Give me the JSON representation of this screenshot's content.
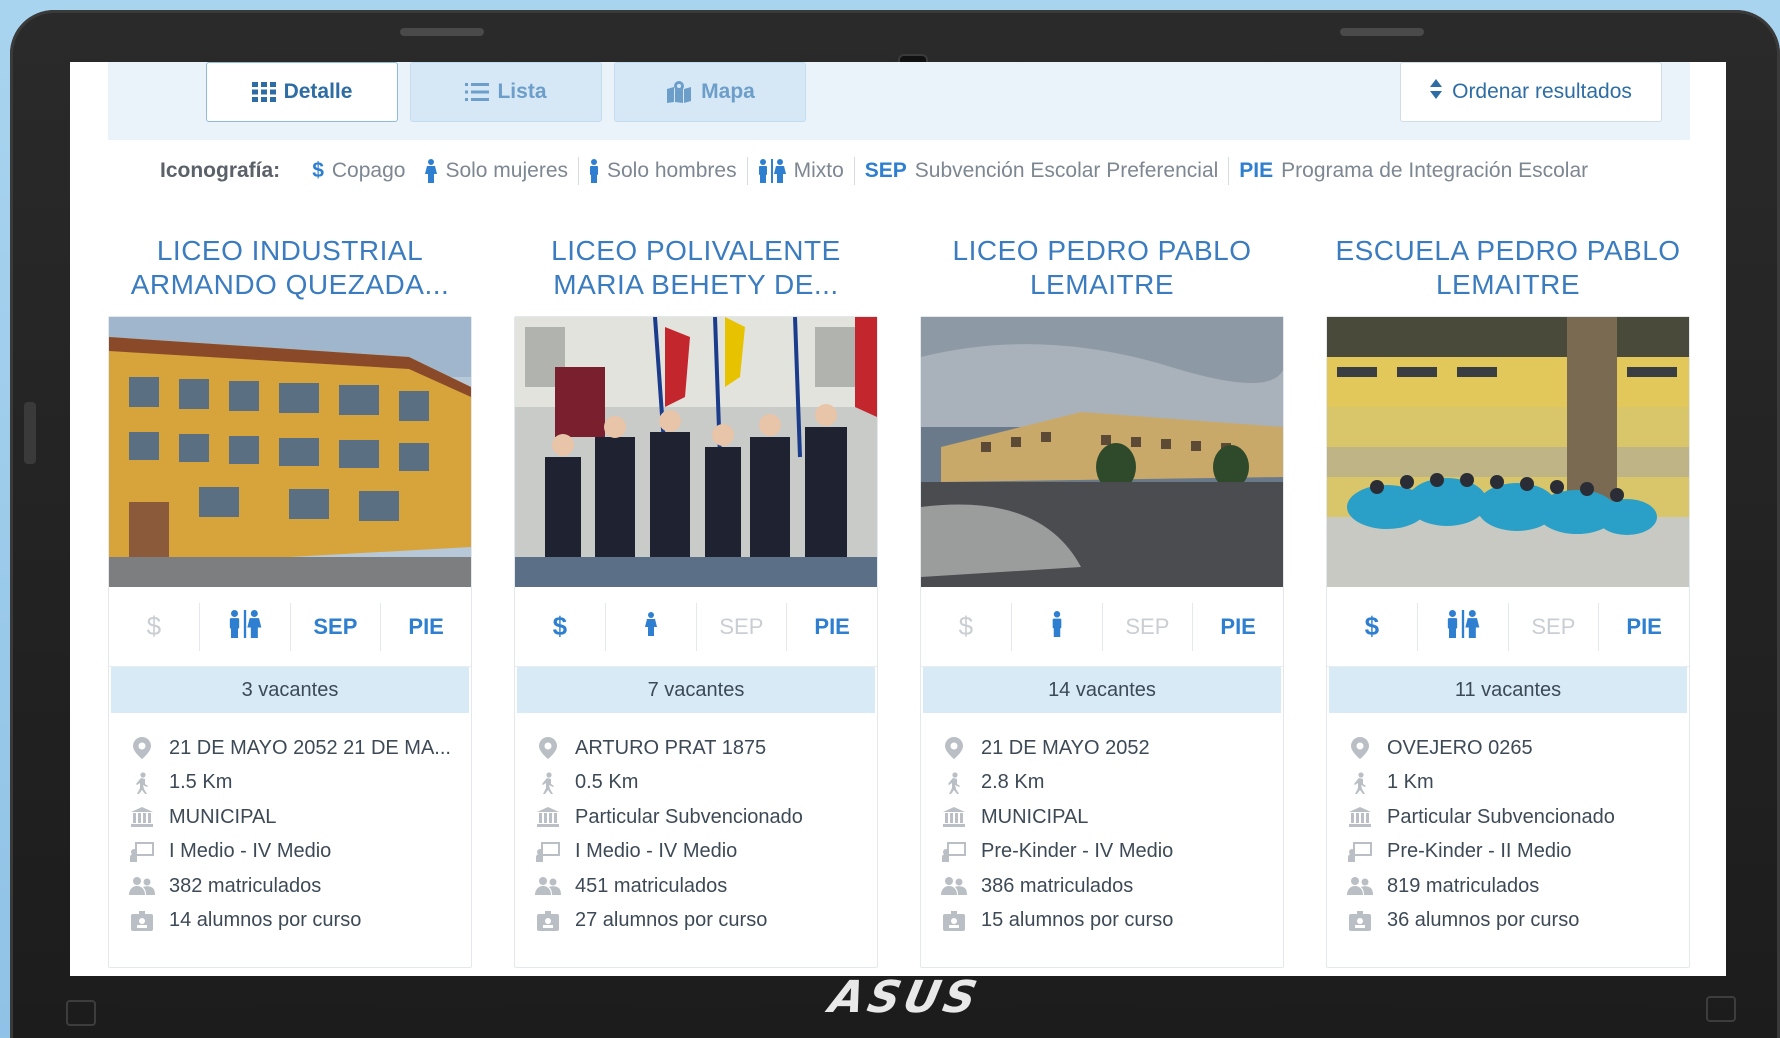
{
  "toolbar": {
    "view_detail": "Detalle",
    "view_list": "Lista",
    "view_map": "Mapa",
    "sort_label": "Ordenar resultados"
  },
  "legend": {
    "title": "Iconografía:",
    "copago": "Copago",
    "solo_mujeres": "Solo mujeres",
    "solo_hombres": "Solo hombres",
    "mixto": "Mixto",
    "sep_code": "SEP",
    "sep_text": "Subvención Escolar Preferencial",
    "pie_code": "PIE",
    "pie_text": "Programa de Integración Escolar"
  },
  "icon_labels": {
    "sep": "SEP",
    "pie": "PIE",
    "dollar": "$"
  },
  "colors": {
    "accent": "#2e7fd0",
    "title": "#3a7cbf",
    "vacantes_bg": "#d9eaf7",
    "disabled": "#c9ced3"
  },
  "schools": [
    {
      "title_line1": "LICEO INDUSTRIAL",
      "title_line2": "ARMANDO QUEZADA...",
      "copago": false,
      "gender": "mixto",
      "sep": true,
      "pie": true,
      "vacantes": "3 vacantes",
      "address": "21 DE MAYO 2052 21 DE MA...",
      "distance": "1.5 Km",
      "dependency": "MUNICIPAL",
      "levels": "I Medio - IV Medio",
      "enrolled": "382 matriculados",
      "per_course": "14 alumnos por curso"
    },
    {
      "title_line1": "LICEO POLIVALENTE",
      "title_line2": "MARIA BEHETY DE...",
      "copago": true,
      "gender": "mujeres",
      "sep": false,
      "pie": true,
      "vacantes": "7 vacantes",
      "address": "ARTURO PRAT 1875",
      "distance": "0.5 Km",
      "dependency": "Particular Subvencionado",
      "levels": "I Medio - IV Medio",
      "enrolled": "451 matriculados",
      "per_course": "27 alumnos por curso"
    },
    {
      "title_line1": "LICEO PEDRO PABLO",
      "title_line2": "LEMAITRE",
      "copago": false,
      "gender": "hombres",
      "sep": false,
      "pie": true,
      "vacantes": "14 vacantes",
      "address": "21 DE MAYO 2052",
      "distance": "2.8 Km",
      "dependency": "MUNICIPAL",
      "levels": "Pre-Kinder - IV Medio",
      "enrolled": "386 matriculados",
      "per_course": "15 alumnos por curso"
    },
    {
      "title_line1": "ESCUELA PEDRO PABLO",
      "title_line2": "LEMAITRE",
      "copago": true,
      "gender": "mixto",
      "sep": false,
      "pie": true,
      "vacantes": "11 vacantes",
      "address": "OVEJERO 0265",
      "distance": "1 Km",
      "dependency": "Particular Subvencionado",
      "levels": "Pre-Kinder - II Medio",
      "enrolled": "819 matriculados",
      "per_course": "36 alumnos por curso"
    }
  ]
}
